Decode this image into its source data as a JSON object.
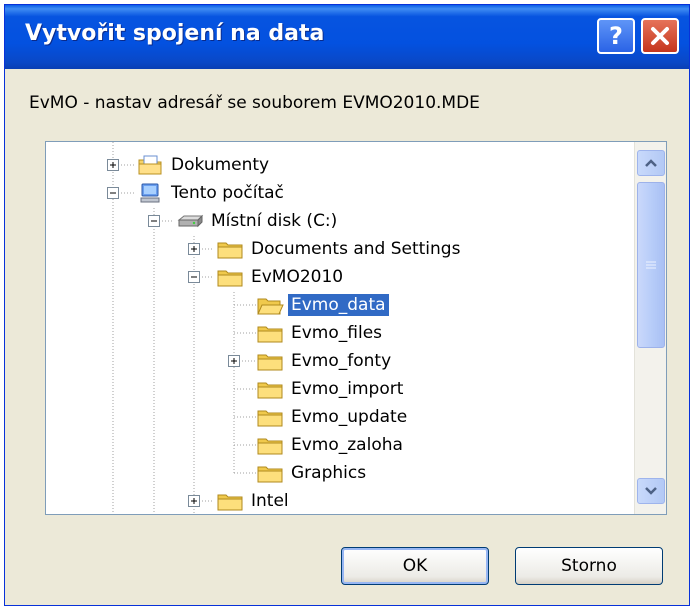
{
  "dialog": {
    "title": "Vytvořit spojení na data",
    "description": "EvMO - nastav adresář se souborem EVMO2010.MDE",
    "help_symbol": "?",
    "ok_label": "OK",
    "cancel_label": "Storno"
  },
  "tree": {
    "items": [
      {
        "label": "Dokumenty",
        "icon": "documents-folder-icon",
        "expander": "plus"
      },
      {
        "label": "Tento počítač",
        "icon": "my-computer-icon",
        "expander": "minus"
      },
      {
        "label": "Místní disk (C:)",
        "icon": "hard-drive-icon",
        "expander": "minus"
      },
      {
        "label": "Documents and Settings",
        "icon": "folder-icon",
        "expander": "plus"
      },
      {
        "label": "EvMO2010",
        "icon": "folder-icon",
        "expander": "minus"
      },
      {
        "label": "Evmo_data",
        "icon": "open-folder-icon",
        "selected": true
      },
      {
        "label": "Evmo_files",
        "icon": "folder-icon"
      },
      {
        "label": "Evmo_fonty",
        "icon": "folder-icon",
        "expander": "plus"
      },
      {
        "label": "Evmo_import",
        "icon": "folder-icon"
      },
      {
        "label": "Evmo_update",
        "icon": "folder-icon"
      },
      {
        "label": "Evmo_zaloha",
        "icon": "folder-icon"
      },
      {
        "label": "Graphics",
        "icon": "folder-icon"
      },
      {
        "label": "Intel",
        "icon": "folder-icon",
        "expander": "plus"
      }
    ]
  },
  "colors": {
    "titlebar": "#0351e0",
    "selection": "#316ac5",
    "dialog_bg": "#ece9d8",
    "close_button": "#c5361d"
  }
}
